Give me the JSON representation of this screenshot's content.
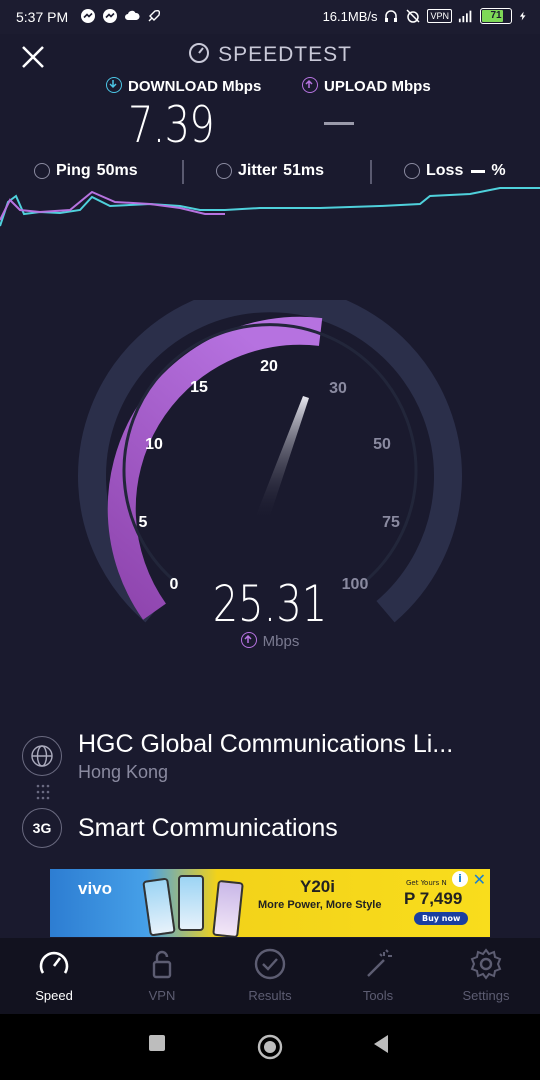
{
  "status_bar": {
    "time": "5:37 PM",
    "speed": "16.1MB/s",
    "vpn": "VPN",
    "battery": "71"
  },
  "header": {
    "title": "SPEEDTEST"
  },
  "results": {
    "download_label": "DOWNLOAD Mbps",
    "upload_label": "UPLOAD Mbps",
    "download_value": "7.39",
    "ping_label": "Ping",
    "ping_value": "50ms",
    "jitter_label": "Jitter",
    "jitter_value": "51ms",
    "loss_label": "Loss",
    "loss_value": "%"
  },
  "gauge": {
    "ticks": [
      "0",
      "5",
      "10",
      "15",
      "20",
      "30",
      "50",
      "75",
      "100"
    ],
    "current_speed": "25.31",
    "unit": "Mbps",
    "fill_color": "#9b59d0",
    "track_color": "#2b2f4a"
  },
  "server": {
    "name": "HGC Global Communications Li...",
    "location": "Hong Kong"
  },
  "isp": {
    "badge": "3G",
    "name": "Smart Communications"
  },
  "ad": {
    "brand": "vivo",
    "model": "Y20i",
    "slogan": "More Power, More Style",
    "price_caption": "Get Yours N",
    "price": "P 7,499",
    "buy": "Buy now"
  },
  "tabs": [
    {
      "label": "Speed",
      "icon": "speedometer-icon",
      "active": true
    },
    {
      "label": "VPN",
      "icon": "lock-icon",
      "active": false
    },
    {
      "label": "Results",
      "icon": "check-circle-icon",
      "active": false
    },
    {
      "label": "Tools",
      "icon": "magic-wand-icon",
      "active": false
    },
    {
      "label": "Settings",
      "icon": "gear-icon",
      "active": false
    }
  ],
  "colors": {
    "background": "#1a1a2e",
    "download_accent": "#4cc6e6",
    "upload_accent": "#b673e0"
  }
}
